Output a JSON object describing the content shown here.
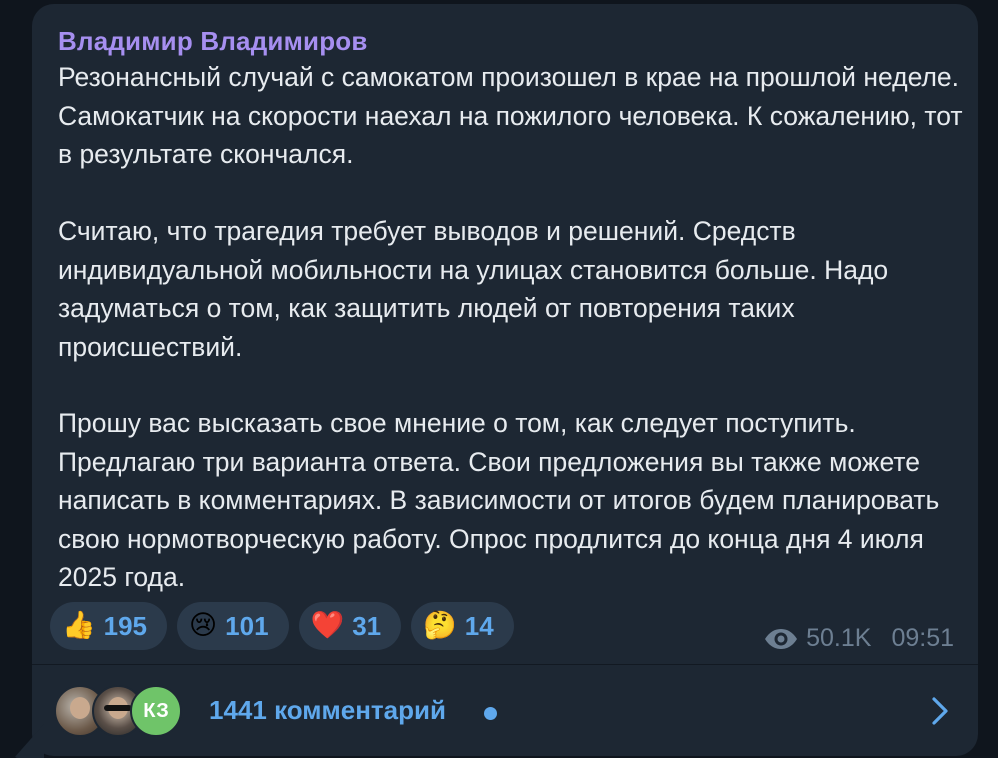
{
  "post": {
    "author": "Владимир Владимиров",
    "paragraphs": [
      "Резонансный случай с самокатом произошел в крае на прошлой неделе. Самокатчик на скорости наехал на пожилого человека. К сожалению, тот в результате скончался.",
      "Считаю, что трагедия требует выводов и решений. Средств индивидуальной мобильности на улицах становится больше. Надо задуматься о том, как защитить людей от повторения таких происшествий.",
      "Прошу вас высказать свое мнение о том, как следует поступить. Предлагаю три варианта ответа. Свои предложения вы также можете написать в комментариях. В зависимости от итогов будем планировать свою нормотворческую работу. Опрос продлится до конца дня 4 июля 2025 года."
    ],
    "reactions": [
      {
        "emoji": "👍",
        "icon": "thumbs-up-emoji",
        "count": "195"
      },
      {
        "emoji": "😢",
        "icon": "crying-face-emoji",
        "count": "101"
      },
      {
        "emoji": "❤️",
        "icon": "red-heart-emoji",
        "count": "31"
      },
      {
        "emoji": "🤔",
        "icon": "thinking-face-emoji",
        "count": "14"
      }
    ],
    "views": "50.1K",
    "time": "09:51",
    "comments": {
      "label": "1441 комментарий",
      "avatar_initials": "КЗ",
      "accent_color": "#5fa8ec"
    }
  },
  "colors": {
    "background": "#0f151d",
    "bubble": "#1d2733",
    "author": "#a68ff0",
    "text": "#e7ebef",
    "meta": "#6d7f92",
    "reaction_bg": "#2b3a4b"
  }
}
